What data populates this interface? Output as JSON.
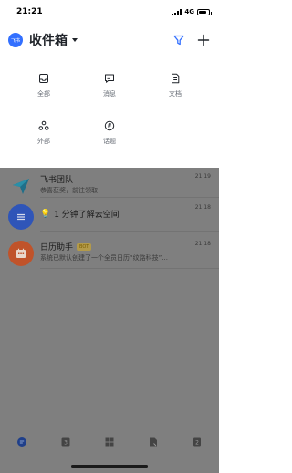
{
  "status_bar": {
    "time": "21:21",
    "network": "4G",
    "battery_level": 0.8
  },
  "header": {
    "avatar_text": "飞书",
    "title": "收件箱"
  },
  "filters": [
    {
      "label": "全部",
      "icon": "inbox-icon"
    },
    {
      "label": "消息",
      "icon": "message-icon"
    },
    {
      "label": "文档",
      "icon": "doc-icon"
    },
    {
      "label": "外部",
      "icon": "external-icon"
    },
    {
      "label": "话题",
      "icon": "topic-icon"
    }
  ],
  "chats": [
    {
      "name": "飞书团队",
      "time": "21:19",
      "preview": "恭喜获奖，前往领取"
    },
    {
      "name": "1 分钟了解云空间",
      "time": "21:18",
      "preview": ""
    },
    {
      "name": "日历助手",
      "badge": "BOT",
      "time": "21:18",
      "preview": "系统已默认创建了一个全员日历“纹路科技”..."
    }
  ],
  "tabbar": {
    "items": [
      "chat-tab-icon",
      "calendar-tab-icon",
      "workspace-tab-icon",
      "docs-tab-icon",
      "contacts-tab-icon"
    ]
  },
  "colors": {
    "accent": "#3370ff",
    "overlay": "#7f7f7f",
    "calendar": "#c0532a",
    "space": "#2f55b8"
  }
}
